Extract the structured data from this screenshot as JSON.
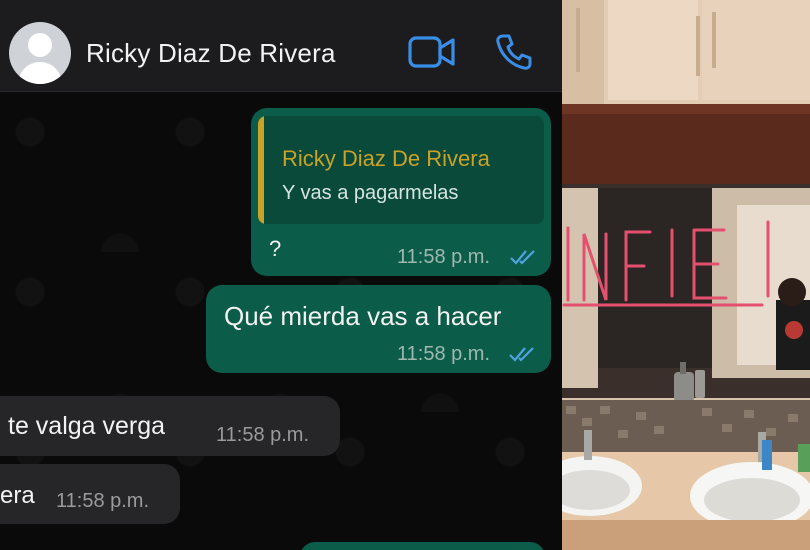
{
  "header": {
    "contact_name": "Ricky Diaz De Rivera",
    "video_icon": "video-camera-icon",
    "call_icon": "phone-icon",
    "accent_color": "#3a8ee6"
  },
  "messages": [
    {
      "direction": "outgoing",
      "quoted": {
        "author": "Ricky Diaz De Rivera",
        "text": "Y vas a pagarmelas"
      },
      "text": "?",
      "time": "11:58 p.m.",
      "status": "read"
    },
    {
      "direction": "outgoing",
      "text": "Qué mierda vas a hacer",
      "time": "11:58 p.m.",
      "status": "read"
    },
    {
      "direction": "incoming",
      "text": "te valga verga",
      "time": "11:58 p.m."
    },
    {
      "direction": "incoming",
      "text": "era",
      "time": "11:58 p.m."
    }
  ],
  "photo": {
    "mirror_text": "INFIE"
  },
  "colors": {
    "outgoing_bubble": "#0b5c48",
    "incoming_bubble": "#262628",
    "quote_accent": "#c9a227",
    "read_ticks": "#4fa3e0"
  }
}
